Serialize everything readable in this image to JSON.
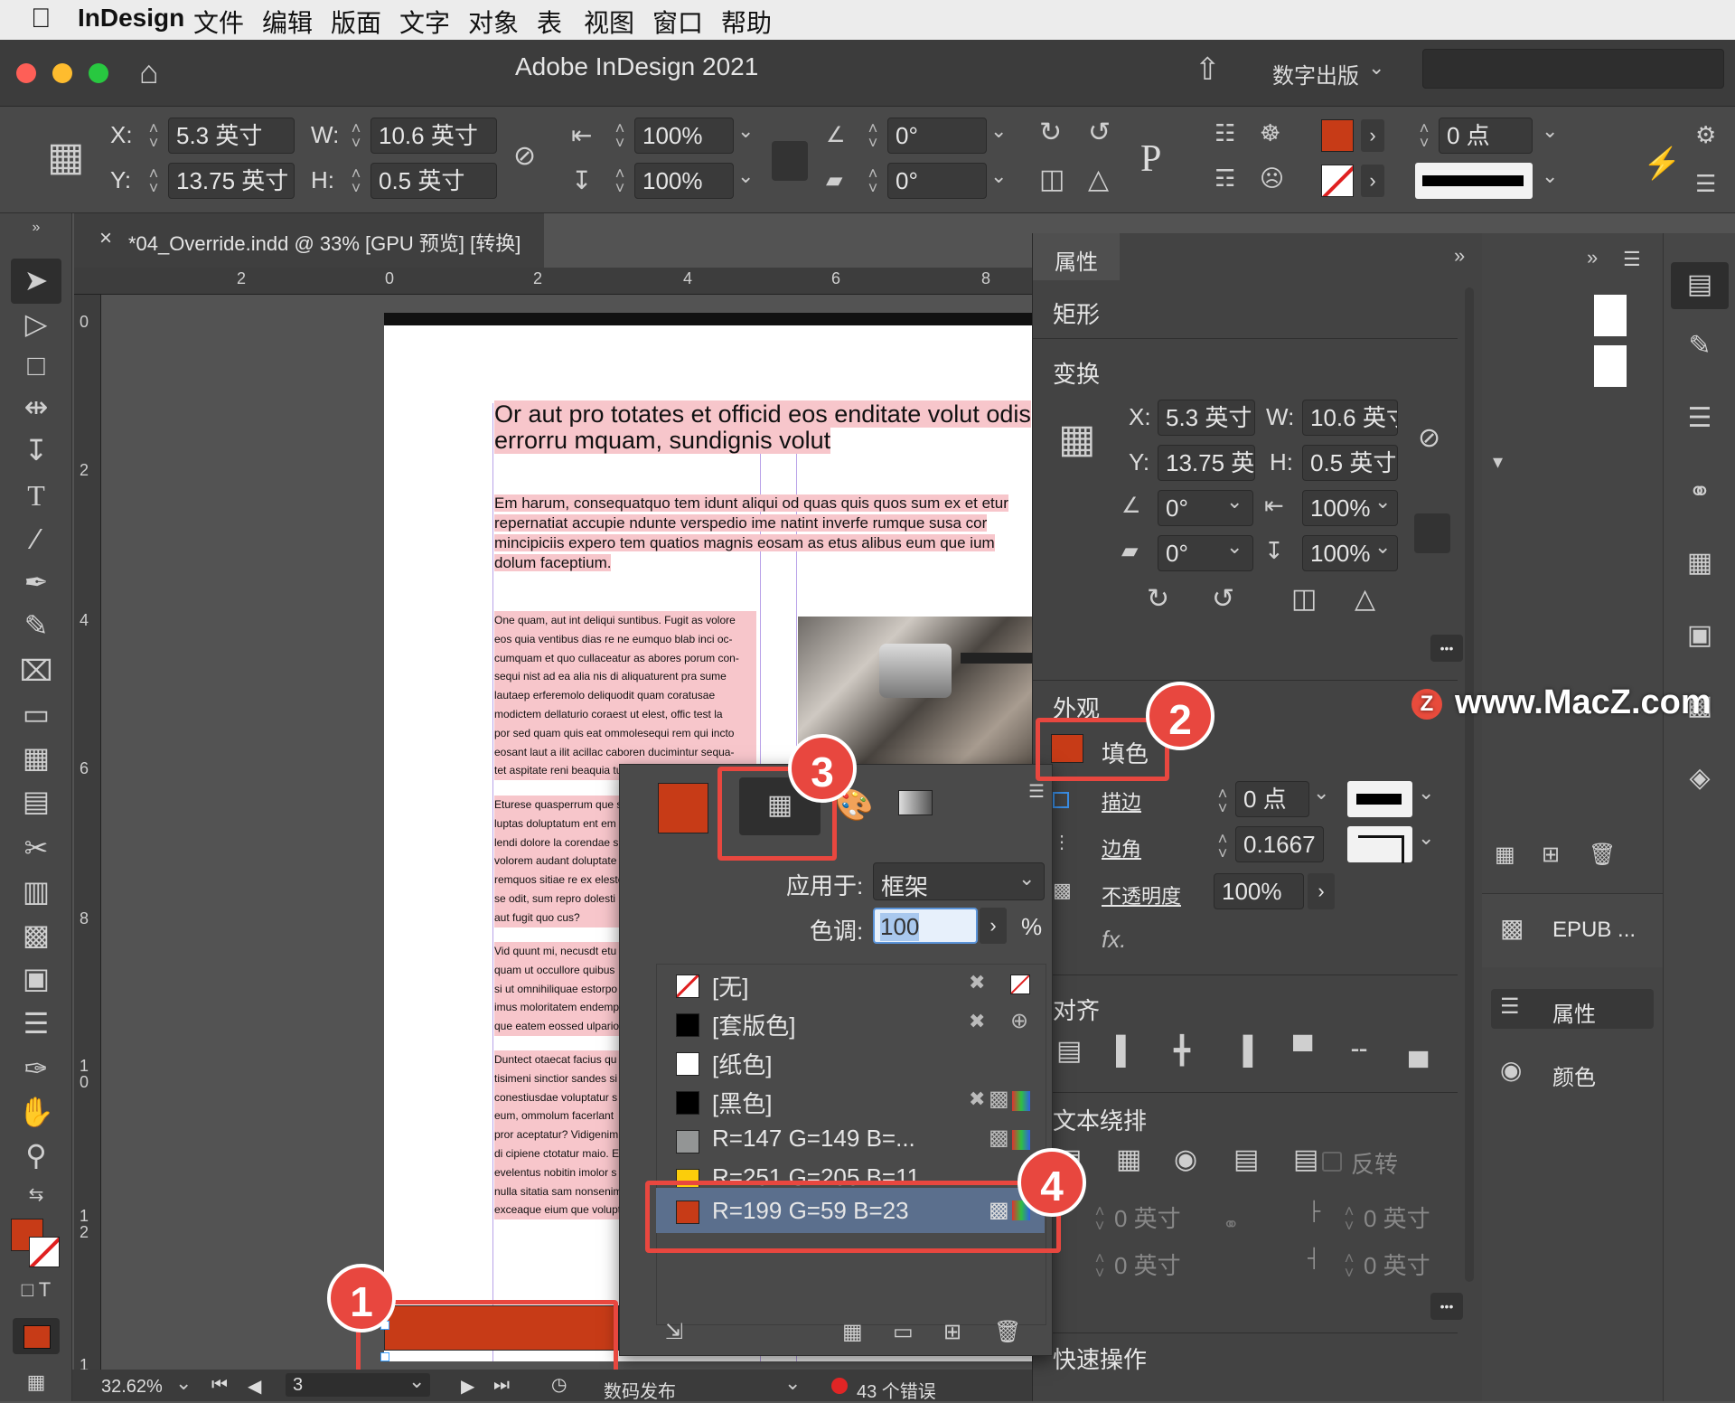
{
  "menubar": {
    "items": [
      "InDesign",
      "文件",
      "编辑",
      "版面",
      "文字",
      "对象",
      "表",
      "视图",
      "窗口",
      "帮助"
    ]
  },
  "titlebar": {
    "title": "Adobe InDesign 2021",
    "workspace": "数字出版"
  },
  "controlbar": {
    "x_label": "X:",
    "x_value": "5.3 英寸",
    "y_label": "Y:",
    "y_value": "13.75 英寸",
    "w_label": "W:",
    "w_value": "10.6 英寸",
    "h_label": "H:",
    "h_value": "0.5 英寸",
    "scale_x": "100%",
    "scale_y": "100%",
    "rotate": "0°",
    "shear": "0°",
    "stroke_weight": "0 点",
    "p_icon": "P"
  },
  "document": {
    "tab_title": "*04_Override.indd @ 33% [GPU 预览] [转换]",
    "close": "×",
    "ruler_top": [
      "2",
      "0",
      "2",
      "4",
      "6",
      "8"
    ],
    "ruler_left": [
      "0",
      "2",
      "4",
      "6",
      "8",
      "1\n0",
      "1\n2",
      "1"
    ],
    "heading": "Or aut pro totates et officid eos enditate volut odis errorru mquam, sundignis volut",
    "intro": "Em harum, consequatquo tem idunt aliqui od quas quis quos sum ex et etur repernatiat accupie ndunte verspedio ime natint inverfe rumque susa cor mincipiciis expero tem quatios magnis eosam as etus alibus eum que ium dolum faceptium.",
    "body_col1": [
      "One quam, aut int deliqui suntibus. Fugit as volore",
      "eos quia ventibus dias re ne eumquo blab inci oc-",
      "cumquam et quo cullaceatur as abores porum con-",
      "sequi nist ad ea alia nis di aliquaturent pra sume",
      "lautaep erferemolo deliquodit quam coratusae",
      "modictem dellaturio coraest ut elest, offic test la",
      "por sed quam quis eat ommolesequi rem qui incto",
      "eosant laut a ilit acillac caboren ducimintur sequa-",
      "tet aspitate reni beaquia tu"
    ],
    "body_col2": [
      "Eturese quasperrum que s",
      "luptas doluptatum ent em",
      "lendi dolore la corendae s",
      "volorem audant doluptate",
      "remquos sitiae re ex elesto",
      "se odit, sum repro dolesti",
      "aut fugit quo cus?"
    ],
    "body_col3": [
      "Vid quunt mi, necusdt etu",
      "quam ut occullore quibus",
      "si ut omnihiliquae estorpo",
      "imus moloritatem endemp",
      "que eatem eossed ulpario."
    ],
    "body_col4": [
      "Duntect otaecat facius qu",
      "tisimeni sinctior sandes si",
      "conestiusdae voluptatur s",
      "eum, ommolum facerlant",
      "pror aceptatur? Vidigenim",
      "di cipiene ctotatur maio. E",
      "evelentus nobitin imolor s",
      "nulla sitatia sam nonsenim",
      "exceaque eium que volupt"
    ]
  },
  "properties": {
    "tab": "属性",
    "object_type": "矩形",
    "transform": "变换",
    "x_label": "X:",
    "x_value": "5.3 英寸",
    "w_label": "W:",
    "w_value": "10.6 英寸",
    "y_label": "Y:",
    "y_value": "13.75 英",
    "h_label": "H:",
    "h_value": "0.5 英寸",
    "rotate": "0°",
    "scale_x": "100%",
    "shear": "0°",
    "scale_y": "100%",
    "appearance": "外观",
    "fill_label": "填色",
    "stroke_label": "描边",
    "stroke_value": "0 点",
    "corner_label": "边角",
    "corner_value": "0.1667",
    "opacity_label": "不透明度",
    "opacity_value": "100%",
    "fx_label": "fx.",
    "align": "对齐",
    "wrap": "文本绕排",
    "invert": "反转",
    "wrap_top": "0 英寸",
    "wrap_left": "0 英寸",
    "wrap_bottom": "0 英寸",
    "wrap_right": "0 英寸",
    "quick_actions": "快速操作",
    "more": "•••"
  },
  "swatch_popup": {
    "apply_label": "应用于:",
    "apply_value": "框架",
    "tint_label": "色调:",
    "tint_value": "100",
    "tint_unit": "%",
    "swatches": [
      {
        "name": "[无]",
        "color": "none"
      },
      {
        "name": "[套版色]",
        "color": "#000000"
      },
      {
        "name": "[纸色]",
        "color": "#ffffff"
      },
      {
        "name": "[黑色]",
        "color": "#000000"
      },
      {
        "name": "R=147 G=149 B=...",
        "color": "#939595"
      },
      {
        "name": "R=251 G=205 B=11",
        "color": "#fbcd0b"
      },
      {
        "name": "R=199 G=59 B=23",
        "color": "#c73b17"
      }
    ],
    "selected_color": "#c73b17"
  },
  "right_panel": {
    "epub": "EPUB ...",
    "properties": "属性",
    "color": "颜色"
  },
  "status": {
    "zoom": "32.62%",
    "page": "3",
    "profile": "数码发布",
    "errors": "43 个错误"
  },
  "watermark": "www.MacZ.com",
  "callouts": [
    "1",
    "2",
    "3",
    "4"
  ],
  "colors": {
    "accent_red": "#c73b17",
    "callout_red": "#e8473f",
    "panel_bg": "#434343"
  }
}
